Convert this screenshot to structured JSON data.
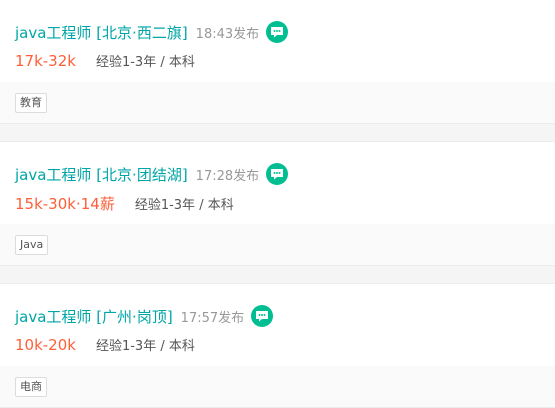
{
  "jobs": [
    {
      "title": "java工程师 [北京·西二旗]",
      "time": "18:43发布",
      "salary": "17k-32k",
      "requirements": "经验1-3年 / 本科",
      "tag": "教育",
      "chat_icon": "chat-bubble-icon"
    },
    {
      "title": "java工程师 [北京·团结湖]",
      "time": "17:28发布",
      "salary": "15k-30k·14薪",
      "requirements": "经验1-3年 / 本科",
      "tag": "Java",
      "chat_icon": "chat-bubble-icon"
    },
    {
      "title": "java工程师 [广州·岗顶]",
      "time": "17:57发布",
      "salary": "10k-20k",
      "requirements": "经验1-3年 / 本科",
      "tag": "电商",
      "chat_icon": "chat-bubble-icon"
    }
  ],
  "colors": {
    "title": "#00a6a7",
    "salary": "#fd5f39",
    "chat": "#00be92",
    "background": "#f5f5f5"
  }
}
